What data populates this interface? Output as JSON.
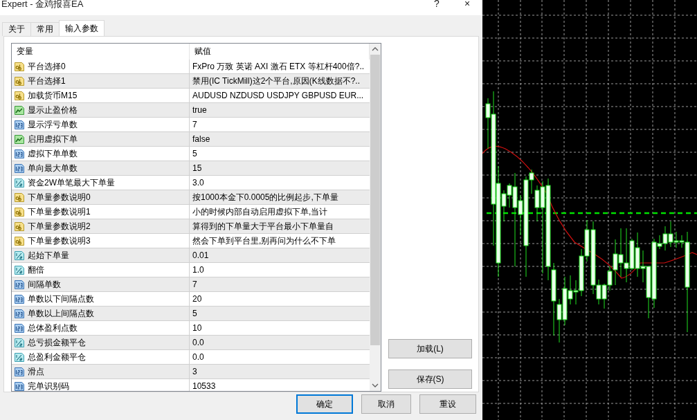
{
  "window": {
    "title": "Expert - 金鸡报喜EA",
    "help": "?",
    "close": "×"
  },
  "tabs": [
    {
      "label": "关于",
      "selected": false
    },
    {
      "label": "常用",
      "selected": false
    },
    {
      "label": "输入参数",
      "selected": true
    }
  ],
  "table": {
    "columns": [
      "变量",
      "赋值"
    ],
    "rows": [
      {
        "kind": "string",
        "name": "平台选择0",
        "value": "FxPro 万致 英诺 AXI 激石 ETX 等杠杆400倍?.."
      },
      {
        "kind": "string",
        "name": "平台选择1",
        "value": "禁用(IC TickMill)这2个平台,原因(K线数据不?.."
      },
      {
        "kind": "string",
        "name": "加载货币M15",
        "value": "AUDUSD NZDUSD USDJPY GBPUSD EUR..."
      },
      {
        "kind": "bool",
        "name": "显示止盈价格",
        "value": "true"
      },
      {
        "kind": "int",
        "name": "显示浮亏单数",
        "value": "7"
      },
      {
        "kind": "bool",
        "name": "启用虚拟下单",
        "value": "false"
      },
      {
        "kind": "int",
        "name": "虚拟下单单数",
        "value": "5"
      },
      {
        "kind": "int",
        "name": "单向最大单数",
        "value": "15"
      },
      {
        "kind": "double",
        "name": "资金2W单笔最大下单量",
        "value": "3.0"
      },
      {
        "kind": "string",
        "name": "下单量参数说明0",
        "value": "按1000本金下0.0005的比例起步,下单量"
      },
      {
        "kind": "string",
        "name": "下单量参数说明1",
        "value": "小的时候内部自动启用虚拟下单,当计"
      },
      {
        "kind": "string",
        "name": "下单量参数说明2",
        "value": "算得到的下单量大于平台最小下单量自"
      },
      {
        "kind": "string",
        "name": "下单量参数说明3",
        "value": "然会下单到平台里,别再问为什么不下单"
      },
      {
        "kind": "double",
        "name": "起始下单量",
        "value": "0.01"
      },
      {
        "kind": "double",
        "name": "翻倍",
        "value": "1.0"
      },
      {
        "kind": "int",
        "name": "间隔单数",
        "value": "7"
      },
      {
        "kind": "int",
        "name": "单数以下间隔点数",
        "value": "20"
      },
      {
        "kind": "int",
        "name": "单数以上间隔点数",
        "value": "5"
      },
      {
        "kind": "int",
        "name": "总体盈利点数",
        "value": "10"
      },
      {
        "kind": "double",
        "name": "总亏损金额平仓",
        "value": "0.0"
      },
      {
        "kind": "double",
        "name": "总盈利金额平仓",
        "value": "0.0"
      },
      {
        "kind": "int",
        "name": "滑点",
        "value": "3"
      },
      {
        "kind": "int",
        "name": "完单识别码",
        "value": "10533"
      }
    ]
  },
  "side_buttons": [
    "加载(L)",
    "保存(S)"
  ],
  "buttons": [
    {
      "label": "确定",
      "default": true
    },
    {
      "label": "取消",
      "default": false
    },
    {
      "label": "重设",
      "default": false
    }
  ]
}
